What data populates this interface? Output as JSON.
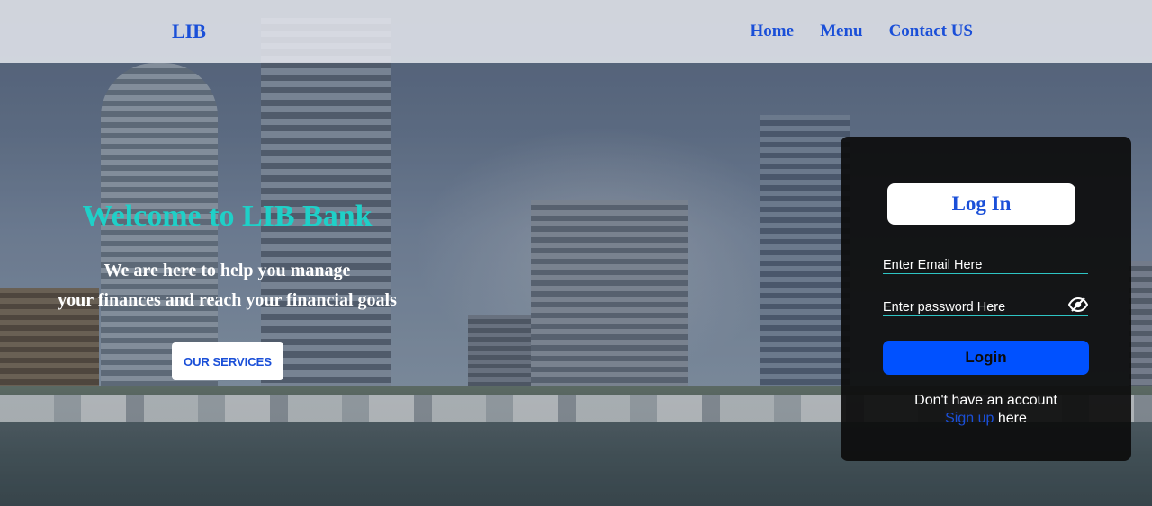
{
  "navbar": {
    "logo": "LIB",
    "links": [
      "Home",
      "Menu",
      "Contact US"
    ]
  },
  "hero": {
    "title": "Welcome to LIB Bank",
    "subtitle_line1": "We are here to help you manage",
    "subtitle_line2": "your finances and reach your financial goals",
    "services_button": "OUR SERVICES"
  },
  "login": {
    "heading": "Log In",
    "email_placeholder": "Enter Email Here",
    "password_placeholder": "Enter password Here",
    "password_toggle_icon": "eye-slash-icon",
    "submit_label": "Login",
    "no_account_text": "Don't have an account",
    "signup_link": "Sign up",
    "signup_suffix": "here"
  },
  "colors": {
    "accent_blue": "#1a4fd8",
    "button_blue": "#0051ff",
    "title_teal": "#1fd0c8",
    "panel_bg": "#0c0c0c"
  }
}
